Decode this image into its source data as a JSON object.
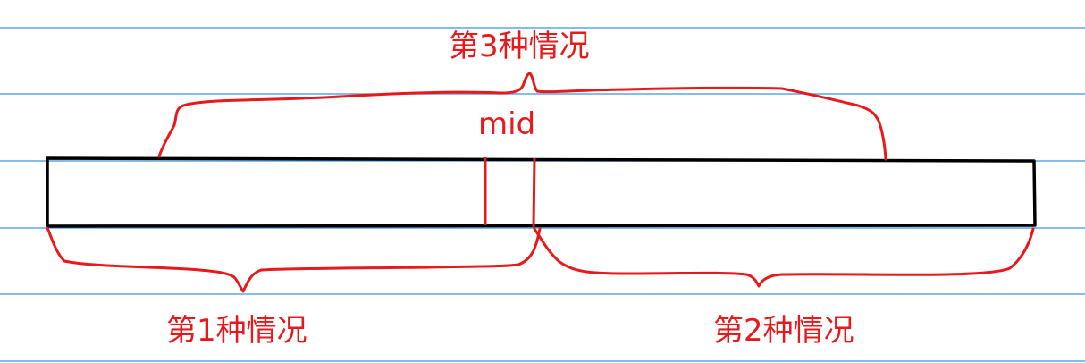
{
  "colors": {
    "background": "#ffffff",
    "ruled_lines": "#5aa6e8",
    "array_outline": "#000000",
    "annotation": "#e8191b"
  },
  "labels": {
    "case3": "第3种情况",
    "mid": "mid",
    "case1": "第1种情况",
    "case2": "第2种情况"
  }
}
